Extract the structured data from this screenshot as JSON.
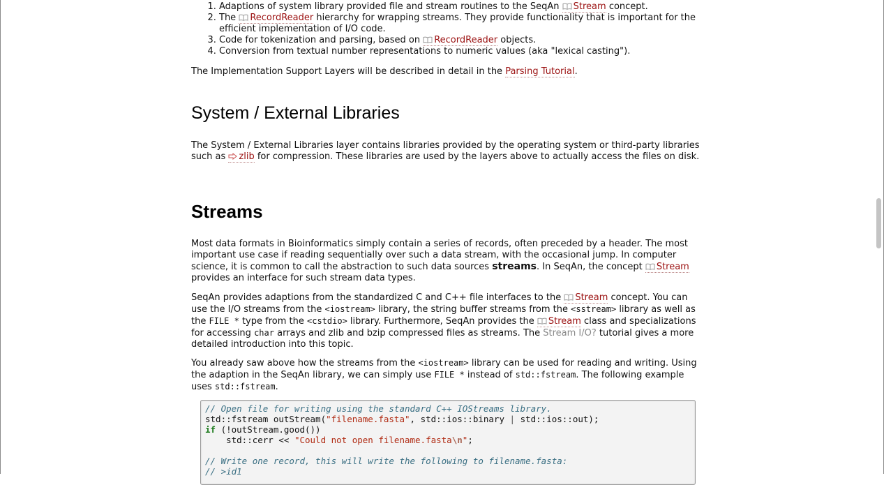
{
  "list": {
    "item1": {
      "a": "Adaptions of system library provided file and stream routines to the SeqAn ",
      "link": "Stream",
      "b": " concept."
    },
    "item2": {
      "a": "The ",
      "link": "RecordReader",
      "b": " hierarchy for wrapping streams. They provide functionality that is important for the efficient implementation of I/O code."
    },
    "item3": {
      "a": "Code for tokenization and parsing, based on ",
      "link": "RecordReader",
      "b": " objects."
    },
    "item4": {
      "a": "Conversion from textual number representations to numeric values (aka \"lexical casting\")."
    }
  },
  "impl_para": {
    "a": "The Implementation Support Layers will be described in detail in the ",
    "link": "Parsing Tutorial",
    "b": "."
  },
  "sys_heading": "System / External Libraries",
  "sys_para": {
    "a": "The System / External Libraries layer contains libraries provided by the operating system or third-party libraries such as ",
    "link": "zlib",
    "b": " for compression. These libraries are used by the layers above to actually access the files on disk."
  },
  "streams_heading": "Streams",
  "streams_p1": {
    "a": "Most data formats in Bioinformatics simply contain a series of records, often preceded by a header. The most important use case if reading sequentially over such a data stream, with the occasional jump. In computer science, it is common to call the abstraction to such data sources ",
    "strong": "streams",
    "b": ". In SeqAn, the concept ",
    "link": "Stream",
    "c": " provides an interface for such stream data types."
  },
  "streams_p2": {
    "a": "SeqAn provides adaptions from the standardized C and C++ file interfaces to the ",
    "link1": "Stream",
    "b": " concept. You can use the I/O streams from the ",
    "code1": "<iostream>",
    "c": " library, the string buffer streams from the ",
    "code2": "<sstream>",
    "d": " library as well as the ",
    "code3": "FILE *",
    "e": " type from the ",
    "code4": "<cstdio>",
    "f": " library. Furthermore, SeqAn provides the ",
    "link2": "Stream",
    "g": " class and specializations for accessing ",
    "code5": "char",
    "h": " arrays and zlib and bzip compressed files as streams. The ",
    "link3": "Stream I/O?",
    "i": " tutorial gives a more detailed introduction into this topic."
  },
  "streams_p3": {
    "a": "You already saw above how the streams from the ",
    "code1": "<iostream>",
    "b": " library can be used for reading and writing. Using the adaption in the SeqAn library, we can simply use ",
    "code2": "FILE *",
    "c": " instead of ",
    "code3": "std::fstream",
    "d": ". The following example uses ",
    "code4": "std::fstream",
    "e": "."
  },
  "code": {
    "l1": "// Open file for writing using the standard C++ IOStreams library.",
    "l2a": "std::fstream outStream(",
    "l2s": "\"filename.fasta\"",
    "l2b": ", std::ios::binary ",
    "l2op": "|",
    "l2c": " std::ios::out);",
    "l3kw": "if",
    "l3": " (!outStream.good())",
    "l4a": "    std::cerr << ",
    "l4s": "\"Could not open filename.fasta",
    "l4e": "\\n",
    "l4s2": "\"",
    "l4b": ";",
    "l6": "// Write one record, this will write the following to filename.fasta:",
    "l7": "// >id1"
  },
  "colors": {
    "link": "#9b1111",
    "comment": "#3a6f83",
    "string": "#b02a12",
    "keyword": "#1b7a1b"
  },
  "icons": {
    "concept": "book-icon",
    "external": "arrow-right-icon"
  }
}
